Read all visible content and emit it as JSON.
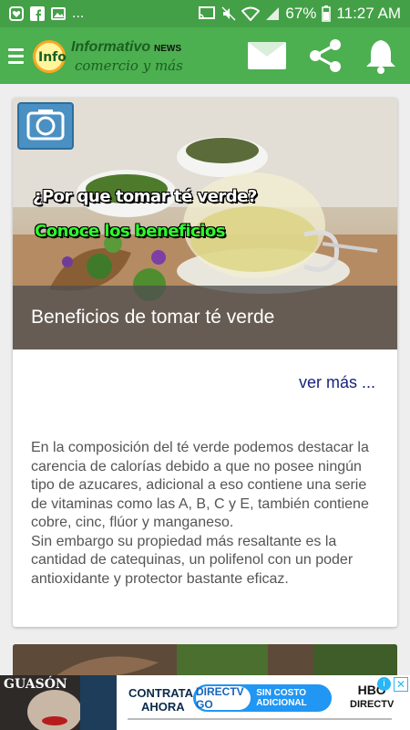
{
  "status_bar": {
    "more_indicator": "...",
    "battery": "67%",
    "time": "11:27 AM"
  },
  "app_bar": {
    "logo_prefix": "Info",
    "logo_title": "Informativo",
    "logo_news": "NEWS",
    "logo_subtitle": "comercio y más"
  },
  "card": {
    "overlay_question": "¿Por que tomar té verde?",
    "overlay_benefits": "Conoce los beneficios",
    "caption": "Beneficios de tomar té verde",
    "ver_mas": "ver más ...",
    "body": "En la composición del té verde podemos destacar la carencia de calorías debido a que no posee ningún tipo de azucares, adicional a eso contiene una serie de vitaminas como las A, B, C y E, también contiene cobre, cinc, flúor y manganeso.\nSin embargo su propiedad más resaltante es la cantidad de catequinas, un polifenol con un poder antioxidante y protector bastante eficaz."
  },
  "ad": {
    "movie": "GUASÓN",
    "contrata": "CONTRATA",
    "ahora": "AHORA",
    "directv_go": "DIRECTV GO",
    "sin_costo": "SIN COSTO ADICIONAL",
    "hbo": "HBO",
    "directv": "DIRECTV",
    "info": "i",
    "close": "✕"
  }
}
